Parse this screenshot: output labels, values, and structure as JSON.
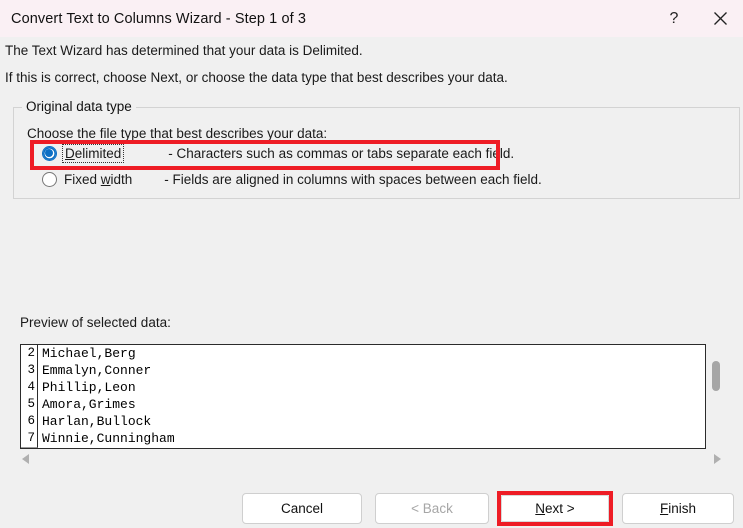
{
  "window": {
    "title": "Convert Text to Columns Wizard - Step 1 of 3",
    "help_icon": "question-mark-icon",
    "close_icon": "close-x-icon",
    "titlebar_color": "#faf0f4",
    "body_color": "#f0f0f0"
  },
  "intro": {
    "line1": "The Text Wizard has determined that your data is Delimited.",
    "line2": "If this is correct, choose Next, or choose the data type that best describes your data."
  },
  "group": {
    "legend": "Original data type",
    "instruction": "Choose the file type that best describes your data:",
    "options": [
      {
        "label": "Delimited",
        "accel": "D",
        "description": "- Characters such as commas or tabs separate each field.",
        "selected": true,
        "focused": true
      },
      {
        "label_pre": "Fixed ",
        "label": "Fixed width",
        "accel": "w",
        "description": "- Fields are aligned in columns with spaces between each field.",
        "selected": false,
        "focused": false
      }
    ]
  },
  "preview": {
    "label": "Preview of selected data:",
    "rows": [
      {
        "num": "2",
        "text": "Michael,Berg"
      },
      {
        "num": "3",
        "text": "Emmalyn,Conner"
      },
      {
        "num": "4",
        "text": "Phillip,Leon"
      },
      {
        "num": "5",
        "text": "Amora,Grimes"
      },
      {
        "num": "6",
        "text": "Harlan,Bullock"
      },
      {
        "num": "7",
        "text": "Winnie,Cunningham"
      }
    ],
    "vertical_scrollbar": "vertical-scrollbar",
    "horizontal_scrollbar": "horizontal-scrollbar"
  },
  "buttons": {
    "cancel": "Cancel",
    "back": "< Back",
    "next": "Next >",
    "next_accel": "N",
    "finish": "Finish",
    "finish_accel": "F",
    "back_disabled": true
  },
  "annotations": {
    "color": "#ee1c25",
    "targets": [
      "delimited-option-row",
      "next-button"
    ]
  }
}
